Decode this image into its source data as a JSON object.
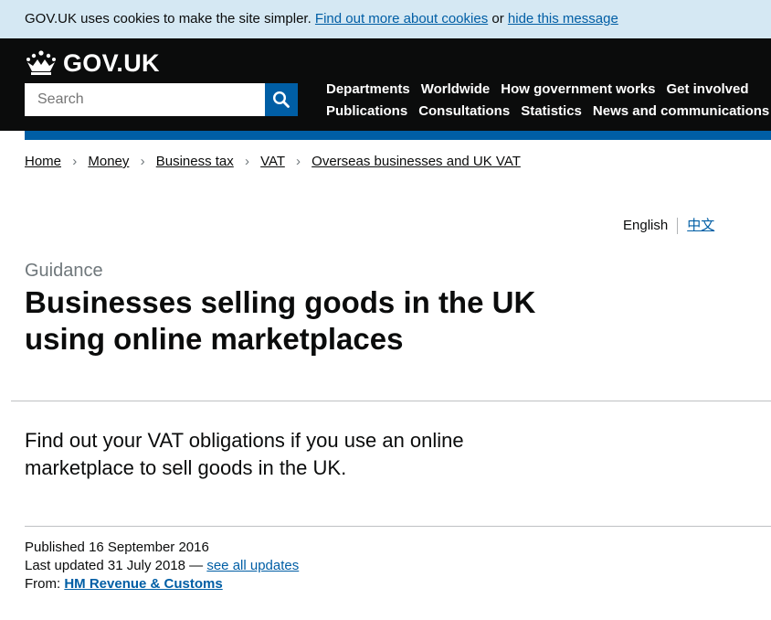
{
  "cookie_banner": {
    "text": "GOV.UK uses cookies to make the site simpler.",
    "find_out_link": "Find out more about cookies",
    "or_text": "or",
    "hide_link": "hide this message"
  },
  "header": {
    "logo_text": "GOV.UK",
    "search_placeholder": "Search",
    "nav_row1": [
      "Departments",
      "Worldwide",
      "How government works",
      "Get involved"
    ],
    "nav_row2": [
      "Publications",
      "Consultations",
      "Statistics",
      "News and communications"
    ]
  },
  "breadcrumb": [
    "Home",
    "Money",
    "Business tax",
    "VAT",
    "Overseas businesses and UK VAT"
  ],
  "language": {
    "current": "English",
    "alternate": "中文"
  },
  "page": {
    "caption": "Guidance",
    "title": "Businesses selling goods in the UK using online marketplaces",
    "lead": "Find out your VAT obligations if you use an online marketplace to sell goods in the UK."
  },
  "metadata": {
    "published_label": "Published",
    "published_date": "16 September 2016",
    "updated_label": "Last updated",
    "updated_date": "31 July 2018",
    "dash": "—",
    "see_updates": "see all updates",
    "from_label": "From:",
    "organisation": "HM Revenue & Customs"
  },
  "colors": {
    "link": "#005ea5",
    "header_bg": "#0b0c0c",
    "cookie_bg": "#d5e8f3",
    "secondary_text": "#6f777b"
  },
  "icons": {
    "logo": "crown-icon",
    "search": "search-icon",
    "breadcrumb_separator": "chevron-right-icon"
  }
}
